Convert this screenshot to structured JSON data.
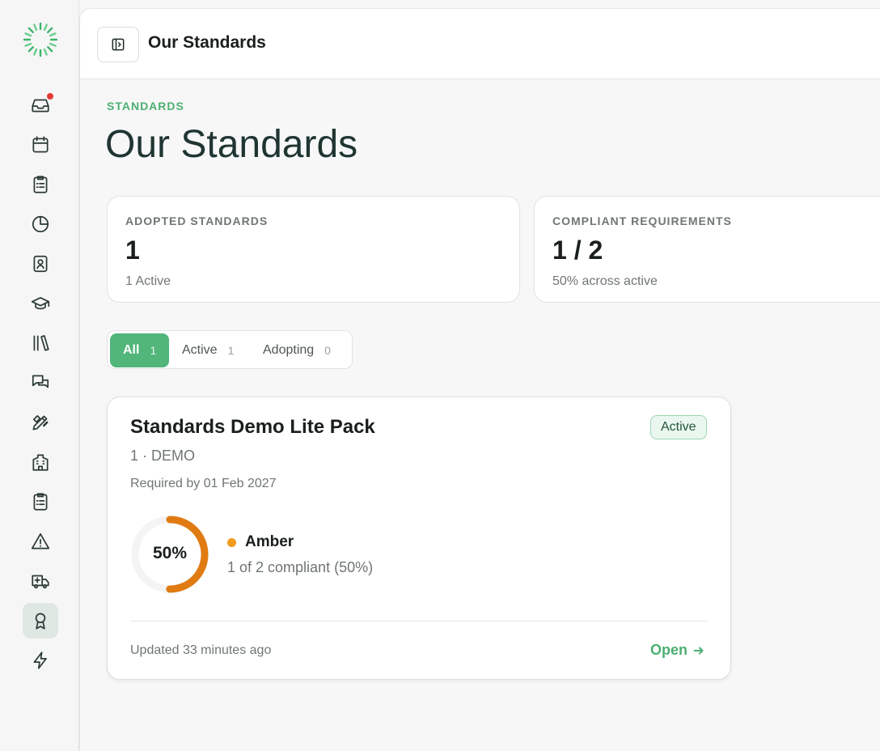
{
  "header": {
    "title": "Our Standards"
  },
  "page": {
    "eyebrow": "STANDARDS",
    "title": "Our Standards"
  },
  "stats": [
    {
      "label": "ADOPTED STANDARDS",
      "value": "1",
      "sub": "1 Active"
    },
    {
      "label": "COMPLIANT REQUIREMENTS",
      "value": "1 / 2",
      "sub": "50% across active"
    }
  ],
  "filters": [
    {
      "label": "All",
      "count": "1",
      "selected": true
    },
    {
      "label": "Active",
      "count": "1",
      "selected": false
    },
    {
      "label": "Adopting",
      "count": "0",
      "selected": false
    }
  ],
  "standard_card": {
    "title": "Standards Demo Lite Pack",
    "code": "1 · DEMO",
    "required_by": "Required by 01 Feb 2027",
    "status": "Active",
    "progress_percent": 50,
    "progress_label": "50%",
    "rating": "Amber",
    "rating_sub": "1 of 2 compliant (50%)",
    "updated": "Updated 33 minutes ago",
    "open_label": "Open"
  },
  "sidebar": {
    "items": [
      {
        "icon": "inbox-icon",
        "has_badge": true
      },
      {
        "icon": "calendar-icon"
      },
      {
        "icon": "checklist-icon"
      },
      {
        "icon": "pie-chart-icon"
      },
      {
        "icon": "contact-book-icon"
      },
      {
        "icon": "graduation-cap-icon"
      },
      {
        "icon": "library-icon"
      },
      {
        "icon": "messages-icon"
      },
      {
        "icon": "design-tools-icon"
      },
      {
        "icon": "building-icon"
      },
      {
        "icon": "clipboard-list-icon"
      },
      {
        "icon": "warning-icon"
      },
      {
        "icon": "ambulance-icon"
      },
      {
        "icon": "award-icon",
        "active": true
      },
      {
        "icon": "lightning-icon"
      }
    ]
  },
  "colors": {
    "accent": "#52b57a",
    "amber": "#e07b12",
    "title": "#1f3532"
  }
}
